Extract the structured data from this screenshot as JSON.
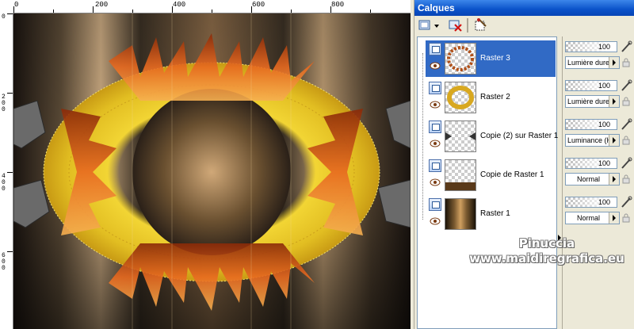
{
  "ruler": {
    "top_labels": [
      "0",
      "200",
      "400",
      "600",
      "800"
    ],
    "left_labels": [
      "0",
      "200",
      "400",
      "600"
    ]
  },
  "palette": {
    "title": "Calques"
  },
  "layers": [
    {
      "name": "Raster 3",
      "selected": true,
      "opacity": "100",
      "blend": "Lumière dure"
    },
    {
      "name": "Raster 2",
      "selected": false,
      "opacity": "100",
      "blend": "Lumière dure"
    },
    {
      "name": "Copie (2) sur Raster 1",
      "selected": false,
      "opacity": "100",
      "blend": "Luminance (H)"
    },
    {
      "name": "Copie de Raster 1",
      "selected": false,
      "opacity": "100",
      "blend": "Normal"
    },
    {
      "name": "Raster 1",
      "selected": false,
      "opacity": "100",
      "blend": "Normal"
    }
  ],
  "watermark": {
    "line1": "Pinuccia",
    "line2": "www.maidiregrafica.eu"
  },
  "colors": {
    "selection": "#316ac5",
    "title_bar": "#0a52c9",
    "panel": "#ece9d8"
  },
  "icons": [
    "new-layer-icon",
    "delete-layer-icon",
    "properties-icon",
    "eye-icon",
    "brush-icon",
    "lock-icon"
  ]
}
